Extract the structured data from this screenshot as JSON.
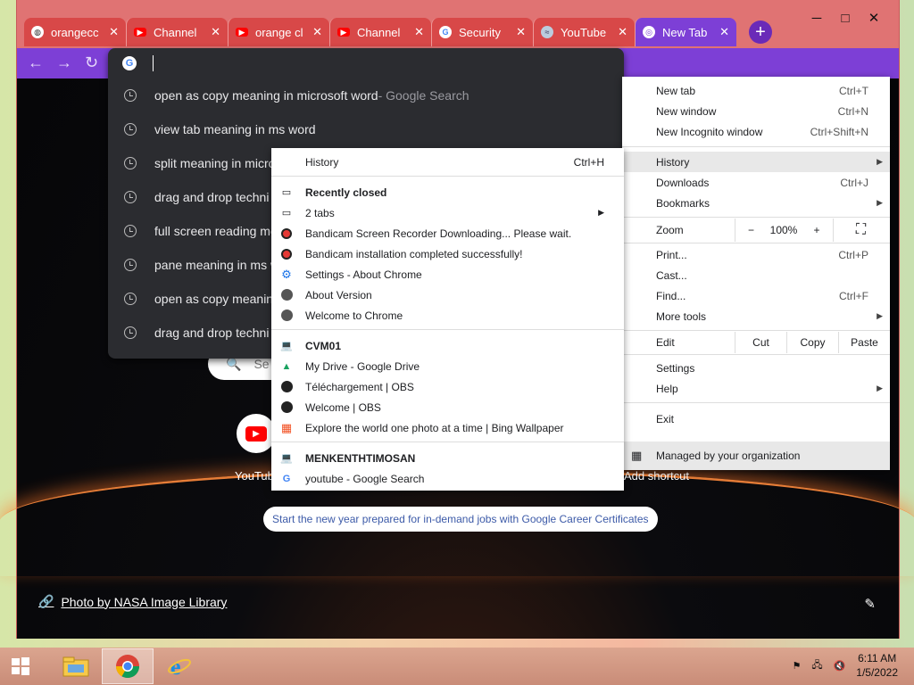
{
  "window": {
    "minimize": "─",
    "maximize": "□",
    "close": "✕"
  },
  "tabs": [
    {
      "title": "orangecc",
      "icon": "globe-icon",
      "active": false
    },
    {
      "title": "Channel",
      "icon": "youtube-icon",
      "active": false
    },
    {
      "title": "orange cl",
      "icon": "youtube-icon",
      "active": false
    },
    {
      "title": "Channel",
      "icon": "youtube-icon",
      "active": false
    },
    {
      "title": "Security",
      "icon": "google-icon",
      "active": false
    },
    {
      "title": "YouTube",
      "icon": "youtube-studio-icon",
      "active": false
    },
    {
      "title": "New Tab",
      "icon": "chrome-icon",
      "active": true
    }
  ],
  "omnibox": {
    "suggestions": [
      {
        "text": "open as copy meaning in microsoft word",
        "suffix": " - Google Search"
      },
      {
        "text": "view tab meaning in ms word",
        "suffix": ""
      },
      {
        "text": "split meaning in micro",
        "suffix": ""
      },
      {
        "text": "drag and drop techni",
        "suffix": ""
      },
      {
        "text": "full screen reading me",
        "suffix": ""
      },
      {
        "text": "pane meaning in ms w",
        "suffix": ""
      },
      {
        "text": "open as copy meanin",
        "suffix": ""
      },
      {
        "text": "drag and drop techni",
        "suffix": ""
      }
    ]
  },
  "ntp": {
    "search_placeholder": "Se",
    "shortcut_youtube": "YouTub",
    "shortcut_add": "Add shortcut",
    "promo": "Start the new year prepared for in-demand jobs with Google Career Certificates",
    "credit": "Photo by NASA Image Library"
  },
  "profile_initial": "G",
  "menu": {
    "new_tab": "New tab",
    "new_tab_sc": "Ctrl+T",
    "new_window": "New window",
    "new_window_sc": "Ctrl+N",
    "incognito": "New Incognito window",
    "incognito_sc": "Ctrl+Shift+N",
    "history": "History",
    "downloads": "Downloads",
    "downloads_sc": "Ctrl+J",
    "bookmarks": "Bookmarks",
    "zoom": "Zoom",
    "zoom_minus": "−",
    "zoom_value": "100%",
    "zoom_plus": "+",
    "print": "Print...",
    "print_sc": "Ctrl+P",
    "cast": "Cast...",
    "find": "Find...",
    "find_sc": "Ctrl+F",
    "more_tools": "More tools",
    "edit": "Edit",
    "cut": "Cut",
    "copy": "Copy",
    "paste": "Paste",
    "settings": "Settings",
    "help": "Help",
    "exit": "Exit",
    "managed": "Managed by your organization"
  },
  "history": {
    "title": "History",
    "title_sc": "Ctrl+H",
    "recently_closed": "Recently closed",
    "items": [
      "2 tabs",
      "Bandicam Screen Recorder Downloading... Please wait.",
      "Bandicam installation completed successfully!",
      "Settings - About Chrome",
      "About Version",
      "Welcome to Chrome"
    ],
    "device1": "CVM01",
    "device1_items": [
      "My Drive - Google Drive",
      "Téléchargement | OBS",
      "Welcome | OBS",
      "Explore the world one photo at a time | Bing Wallpaper"
    ],
    "device2": "MENKENTHTIMOSAN",
    "device2_items": [
      "youtube - Google Search"
    ]
  },
  "taskbar": {
    "time": "6:11 AM",
    "date": "1/5/2022"
  },
  "colors": {
    "tabbar": "#d84848",
    "active_tab": "#7d3fd6",
    "omnibox": "#2b2c30"
  }
}
